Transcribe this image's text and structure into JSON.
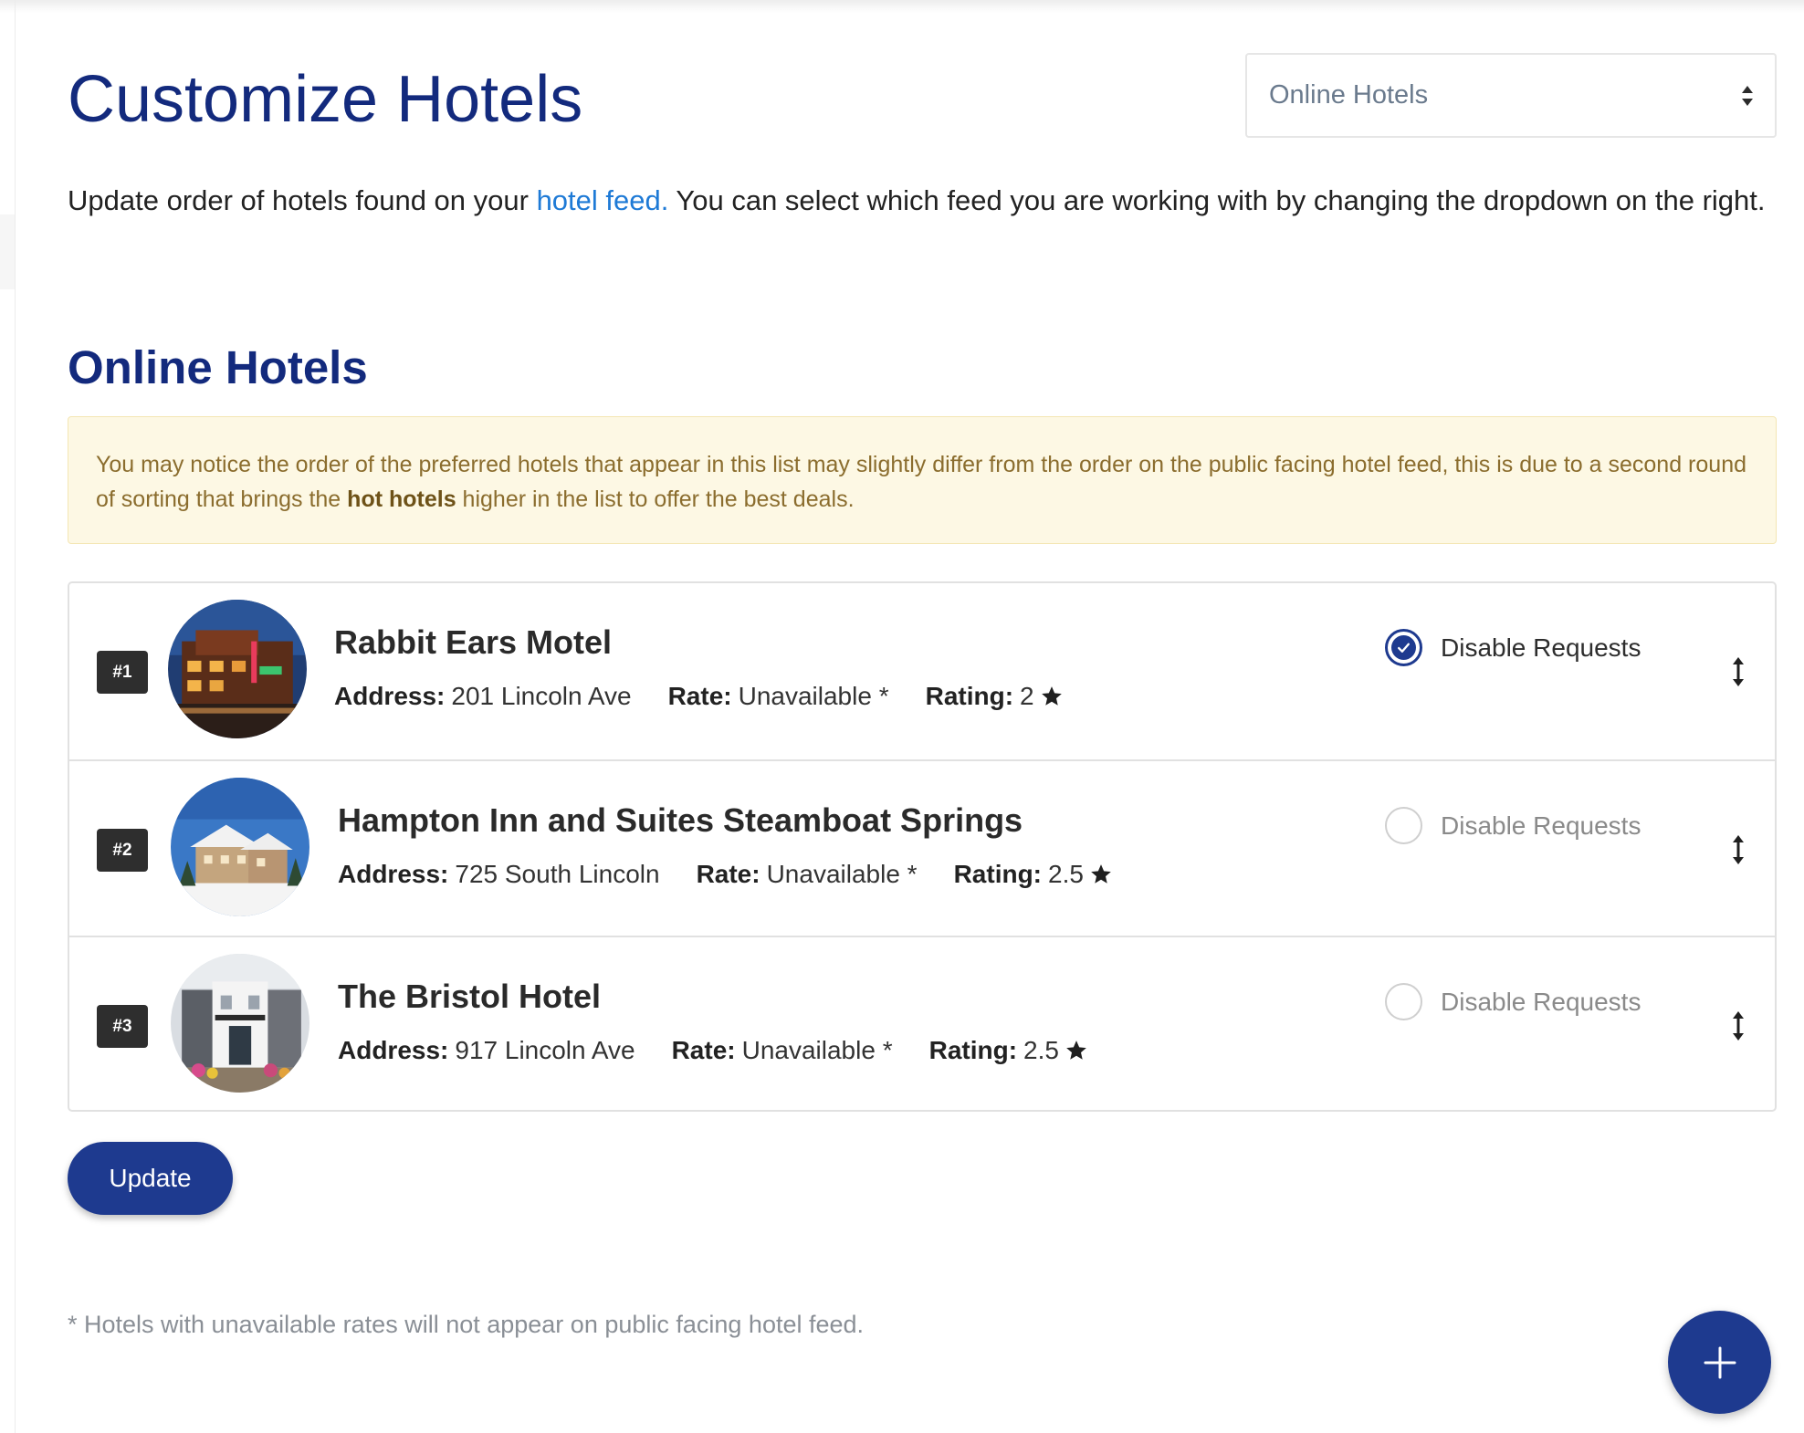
{
  "page": {
    "title": "Customize Hotels",
    "intro_before_link": "Update order of hotels found on your ",
    "intro_link": "hotel feed.",
    "intro_after_link": " You can select which feed you are working with by changing the dropdown on the right."
  },
  "feed_select": {
    "selected": "Online Hotels"
  },
  "section": {
    "title": "Online Hotels"
  },
  "notice": {
    "text_before": "You may notice the order of the preferred hotels that appear in this list may slightly differ from the order on the public facing hotel feed, this is due to a second round of sorting that brings the ",
    "bold": "hot hotels",
    "text_after": " higher in the list to offer the best deals."
  },
  "labels": {
    "address": "Address:",
    "rate": "Rate:",
    "rating": "Rating:",
    "disable_requests": "Disable Requests"
  },
  "hotels": [
    {
      "rank": "#1",
      "name": "Rabbit Ears Motel",
      "address": "201 Lincoln Ave",
      "rate": "Unavailable *",
      "rating": "2",
      "disable_requests": true,
      "thumbnail_icon": "motel-night-photo"
    },
    {
      "rank": "#2",
      "name": "Hampton Inn and Suites Steamboat Springs",
      "address": "725 South Lincoln",
      "rate": "Unavailable *",
      "rating": "2.5",
      "disable_requests": false,
      "thumbnail_icon": "snowy-lodge-photo"
    },
    {
      "rank": "#3",
      "name": "The Bristol Hotel",
      "address": "917 Lincoln Ave",
      "rate": "Unavailable *",
      "rating": "2.5",
      "disable_requests": false,
      "thumbnail_icon": "hotel-entrance-photo"
    }
  ],
  "actions": {
    "update_label": "Update"
  },
  "footnote": "* Hotels with unavailable rates will not appear on public facing hotel feed.",
  "colors": {
    "brand": "#1e3a8f",
    "title": "#132a7d",
    "link": "#1e7ad6",
    "notice_bg": "#fdf8e4",
    "notice_text": "#8b6d2e"
  }
}
